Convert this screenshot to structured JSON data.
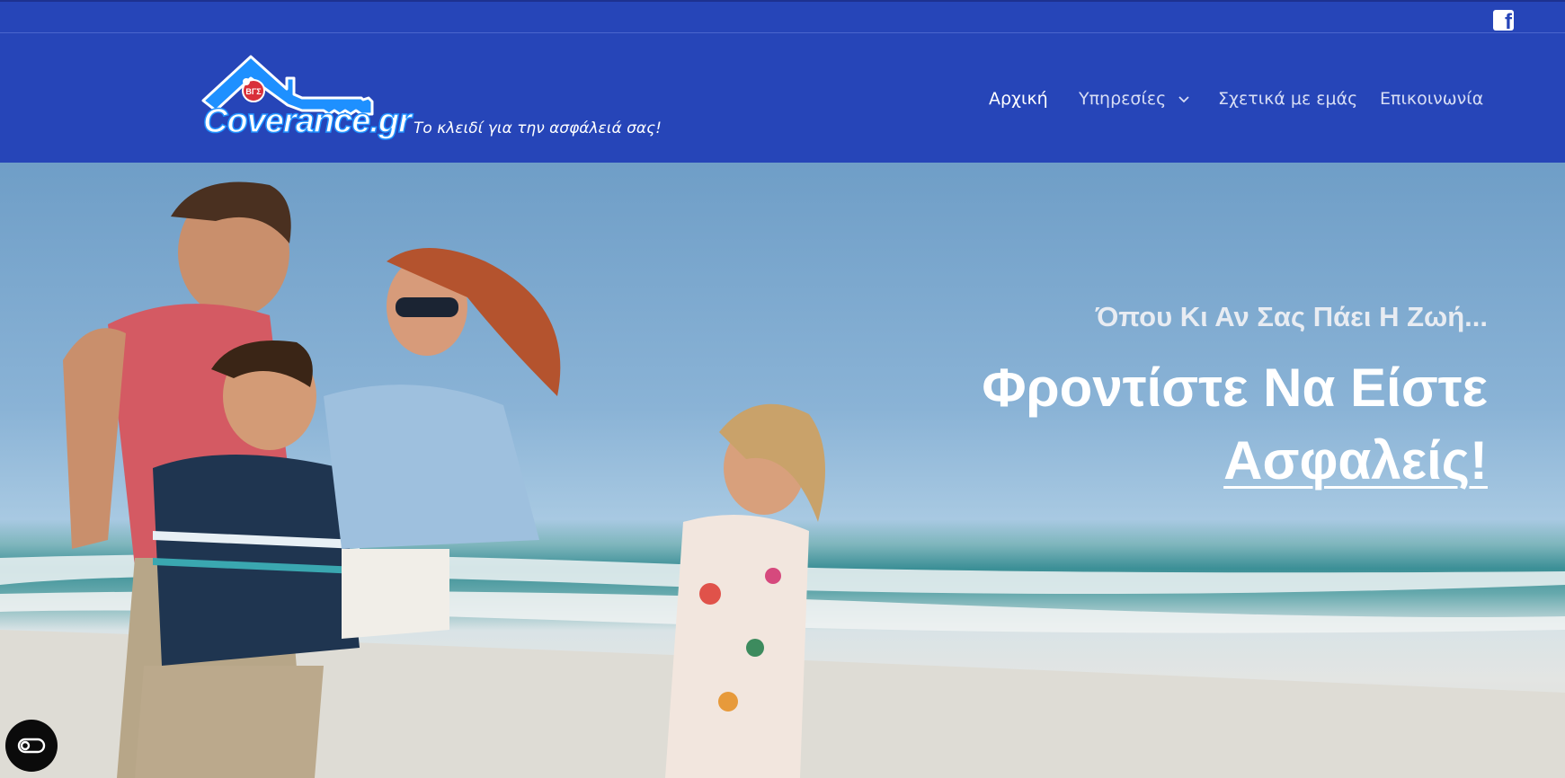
{
  "topbar": {
    "social_icon": "facebook-icon"
  },
  "header": {
    "logo_text": "Coverance.gr",
    "logo_badge": "ΒΓΣ",
    "tagline": "Το κλειδί για την ασφάλειά σας!"
  },
  "nav": {
    "items": [
      {
        "label": "Αρχική",
        "active": true
      },
      {
        "label": "Υπηρεσίες",
        "has_dropdown": true
      },
      {
        "label": "Σχετικά με εμάς"
      },
      {
        "label": "Επικοινωνία"
      }
    ]
  },
  "hero": {
    "subtitle": "Όπου Κι Αν Σας Πάει Η Ζωή...",
    "title_line1": "Φροντίστε Να Είστε",
    "title_line2": "Ασφαλείς!"
  },
  "accessibility": {
    "icon": "accessibility-toggle-icon"
  },
  "colors": {
    "header_bg": "#2645b8",
    "nav_text": "#d8def5",
    "nav_active": "#ffffff",
    "logo_blue": "#1e90ff",
    "accessibility_bg": "#0b0b0b"
  }
}
